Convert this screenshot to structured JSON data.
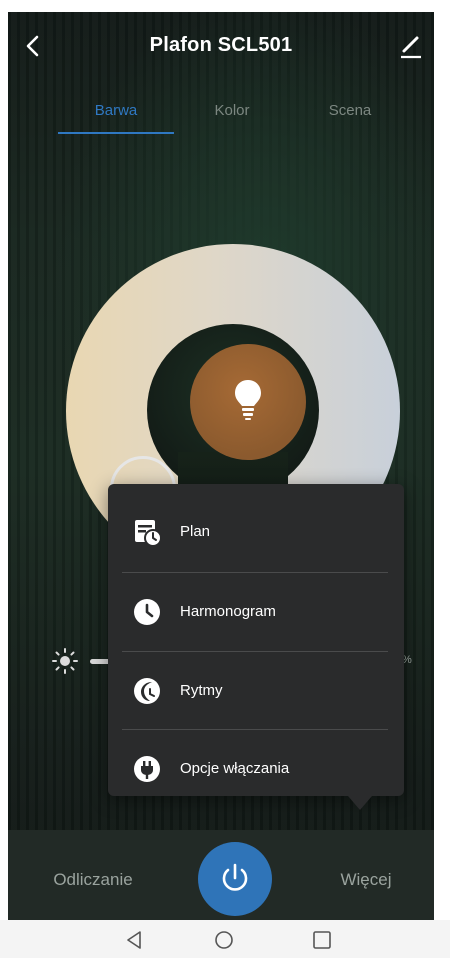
{
  "header": {
    "title": "Plafon SCL501",
    "back_icon": "chevron-left-icon",
    "edit_icon": "pencil-icon"
  },
  "tabs": [
    {
      "label": "Barwa",
      "active": true
    },
    {
      "label": "Kolor",
      "active": false
    },
    {
      "label": "Scena",
      "active": false
    }
  ],
  "wheel": {
    "center_icon": "lightbulb-icon",
    "center_color": "#8b5a2e"
  },
  "slider": {
    "left_icon": "sun-icon",
    "percent_suffix": "%"
  },
  "menu": {
    "items": [
      {
        "label": "Plan",
        "icon": "calendar-clock-icon"
      },
      {
        "label": "Harmonogram",
        "icon": "clock-icon"
      },
      {
        "label": "Rytmy",
        "icon": "moon-rhythm-icon"
      },
      {
        "label": "Opcje włączania",
        "icon": "plug-icon"
      }
    ]
  },
  "bottom_bar": {
    "left_label": "Odliczanie",
    "right_label": "Więcej",
    "power_icon": "power-icon",
    "accent": "#2f74b8"
  },
  "system_nav": {
    "back": "triangle-back-icon",
    "home": "circle-home-icon",
    "recents": "square-recents-icon"
  }
}
